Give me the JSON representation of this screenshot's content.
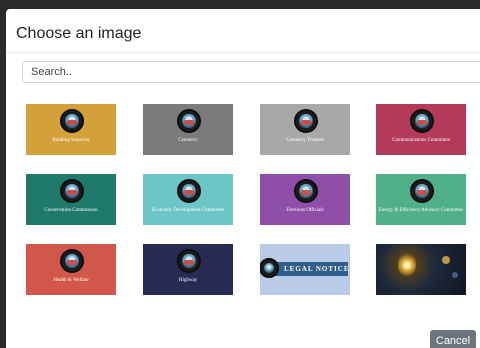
{
  "dialog": {
    "title": "Choose an image",
    "search_placeholder": "Search..",
    "cancel_label": "Cancel"
  },
  "images": [
    {
      "label": "Building Inspector",
      "color": "#d3a03a",
      "kind": "seal"
    },
    {
      "label": "Cemetery",
      "color": "#7b7b7b",
      "kind": "seal"
    },
    {
      "label": "Cemetery Trustees",
      "color": "#a8a8a8",
      "kind": "seal"
    },
    {
      "label": "Communications Committee",
      "color": "#b33a5b",
      "kind": "seal"
    },
    {
      "label": "Conservation Commission",
      "color": "#1f7a6b",
      "kind": "seal"
    },
    {
      "label": "Economic Development Committee",
      "color": "#6cc6c8",
      "kind": "seal"
    },
    {
      "label": "Elections Officials",
      "color": "#8f4fa8",
      "kind": "seal"
    },
    {
      "label": "Energy & Efficiency Advisory Committee",
      "color": "#4fb08a",
      "kind": "seal"
    },
    {
      "label": "Health & Welfare",
      "color": "#d2574b",
      "kind": "seal"
    },
    {
      "label": "Highway",
      "color": "#272a55",
      "kind": "seal"
    },
    {
      "label": "LEGAL NOTICE",
      "color": "#b9cbe6",
      "kind": "legal"
    },
    {
      "label": "",
      "color": "#111a28",
      "kind": "photo"
    }
  ]
}
